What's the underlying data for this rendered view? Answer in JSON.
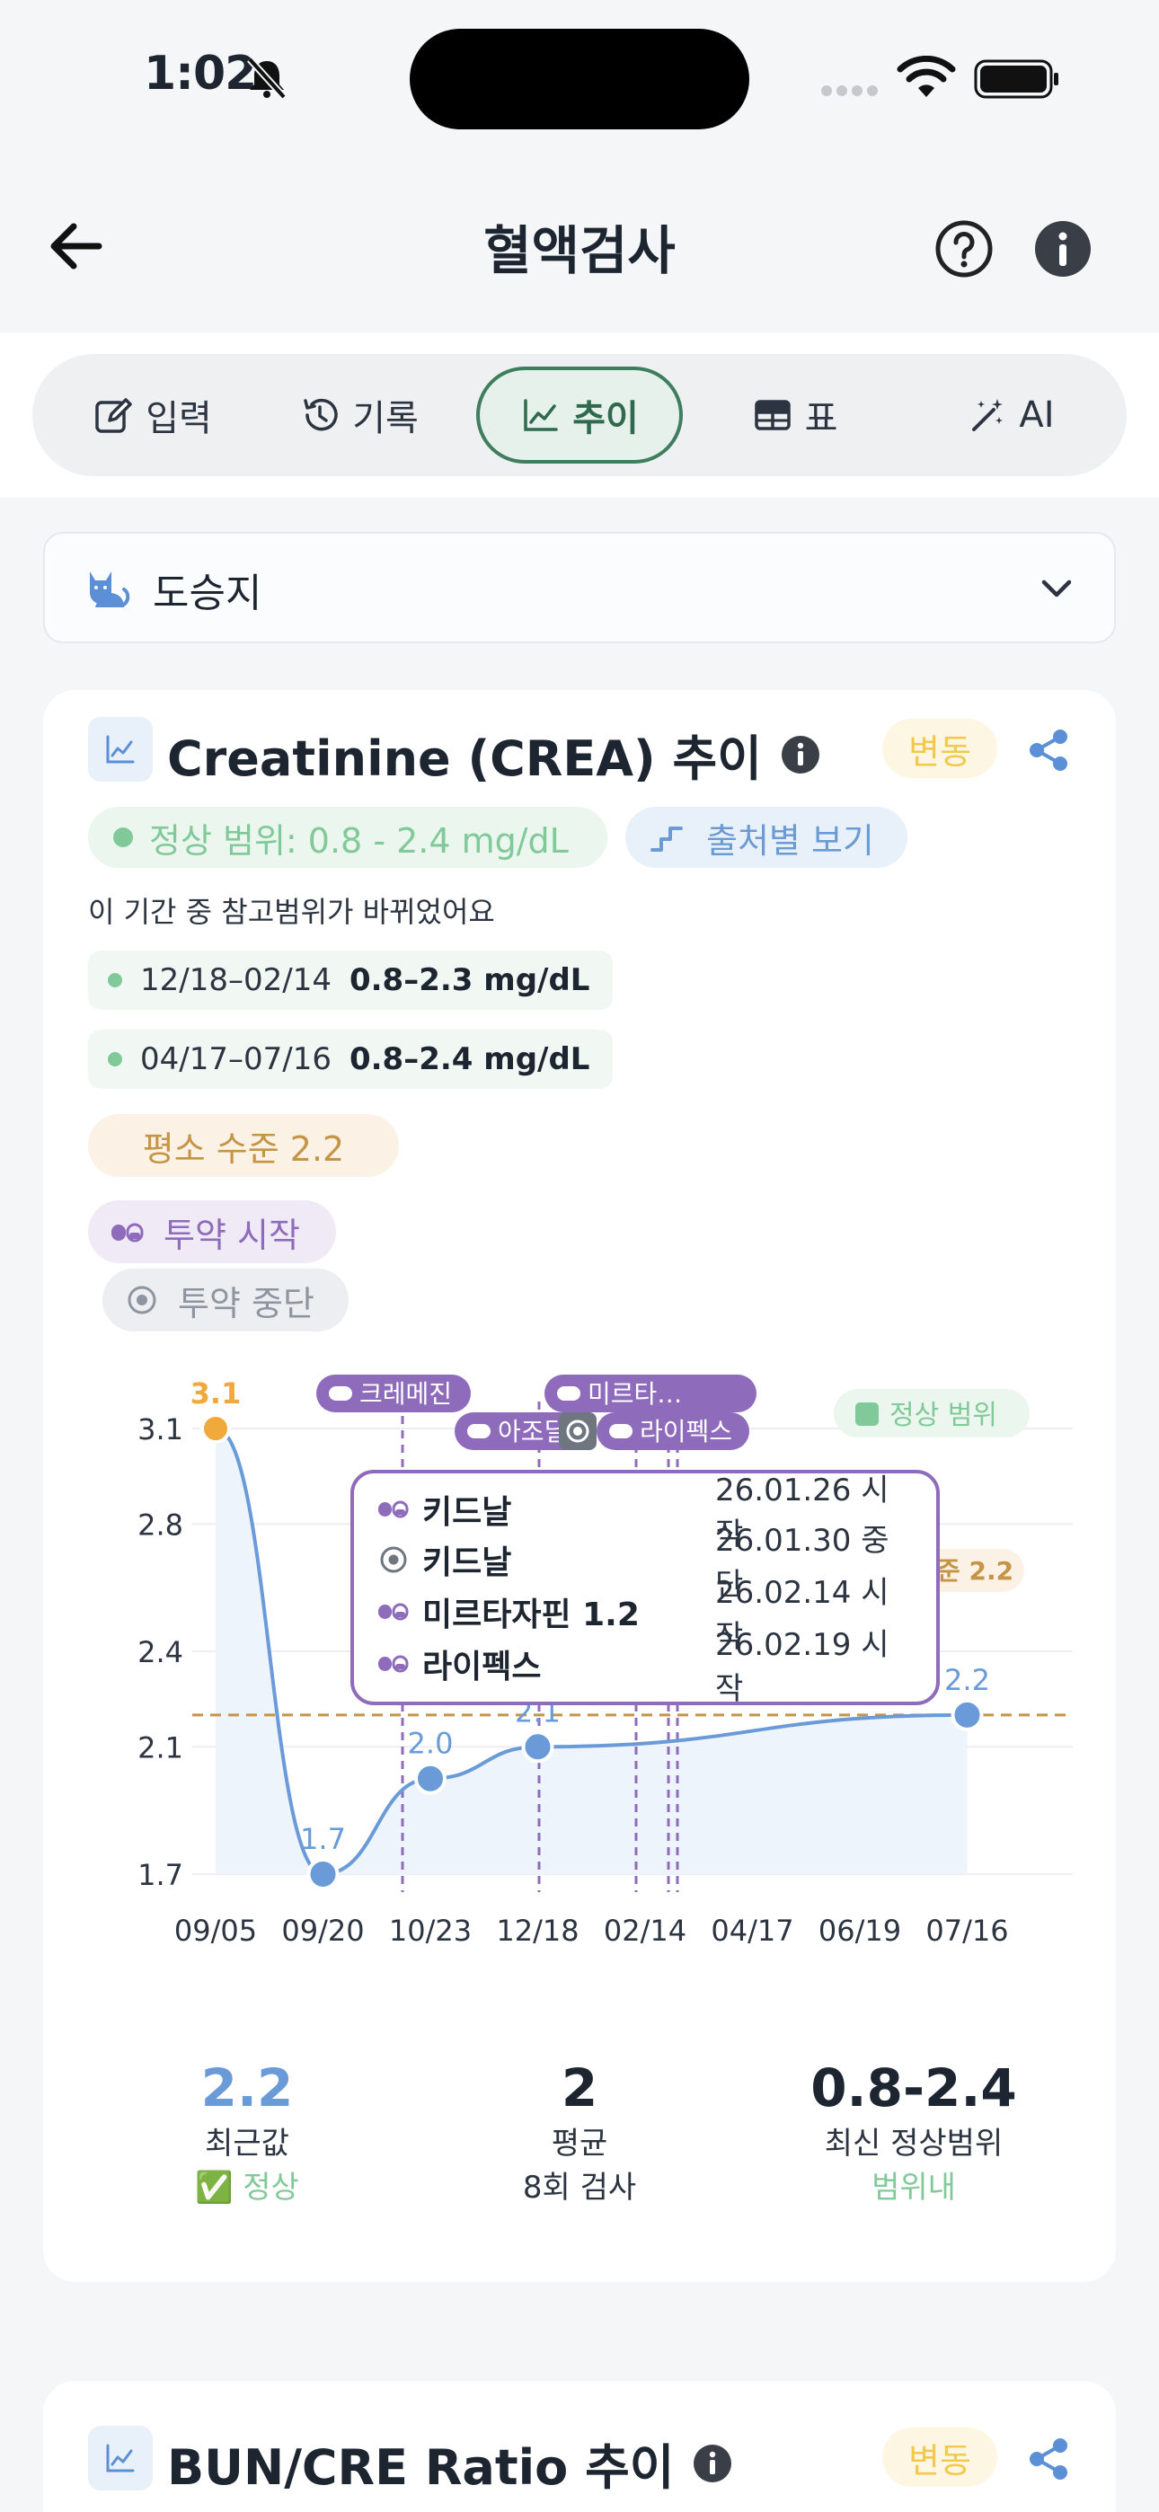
{
  "status": {
    "time": "1:02"
  },
  "header": {
    "title": "혈액검사"
  },
  "tabs": [
    {
      "label": "입력",
      "icon": "edit-icon"
    },
    {
      "label": "기록",
      "icon": "history-icon"
    },
    {
      "label": "추이",
      "icon": "trend-icon",
      "active": true
    },
    {
      "label": "표",
      "icon": "table-icon"
    },
    {
      "label": "AI",
      "icon": "magic-wand-icon"
    }
  ],
  "pet": {
    "name": "도승지"
  },
  "card": {
    "title": "Creatinine (CREA) 추이",
    "badge": "변동",
    "normal_range_pill": "정상 범위: 0.8 - 2.4 mg/dL",
    "source_pill": "출처별 보기",
    "range_note": "이 기간 중 참고범위가 바뀌었어요",
    "ranges": [
      {
        "period": "12/18–02/14",
        "value": "0.8–2.3 mg/dL"
      },
      {
        "period": "04/17–07/16",
        "value": "0.8–2.4 mg/dL"
      }
    ],
    "usual_pill": "평소 수준 2.2",
    "med_start_pill": "투약 시작",
    "med_stop_pill": "투약 중단"
  },
  "chart_data": {
    "type": "line",
    "title": "Creatinine (CREA) 추이",
    "categories": [
      "09/05",
      "09/20",
      "10/23",
      "12/18",
      "02/14",
      "04/17",
      "06/19",
      "07/16"
    ],
    "series": [
      {
        "values": [
          3.1,
          1.7,
          2.0,
          2.1,
          null,
          null,
          null,
          2.2
        ]
      }
    ],
    "point_labels": [
      "3.1",
      "1.7",
      "2.0",
      "2.1",
      "",
      "",
      "",
      "2.2"
    ],
    "y_ticks": [
      "3.1",
      "2.8",
      "2.4",
      "2.1",
      "1.7"
    ],
    "y_tick_values": [
      3.1,
      2.8,
      2.4,
      2.1,
      1.7
    ],
    "ylim": [
      1.7,
      3.1
    ],
    "usual_level": {
      "value": 2.2,
      "label": "평소 수준 2.2"
    },
    "normal_range_legend": "정상 범위",
    "med_markers": [
      {
        "label": "크레메진"
      },
      {
        "label": "아조딜"
      },
      {
        "label": "미르타…"
      },
      {
        "label": "라이펙스"
      }
    ],
    "colors": {
      "line": "#6a9bd8",
      "first_point": "#f2a93b",
      "usual": "#c49547",
      "med": "#8e6cbb",
      "normal": "#82c99a"
    }
  },
  "tooltip": {
    "rows": [
      {
        "icon": "pill-icon",
        "name": "키드날",
        "date": "26.01.26 시작"
      },
      {
        "icon": "stop-icon",
        "name": "키드날",
        "date": "26.01.30 중단"
      },
      {
        "icon": "pill-icon",
        "name": "미르타자핀 1.2",
        "date": "26.02.14 시작"
      },
      {
        "icon": "pill-icon",
        "name": "라이펙스",
        "date": "26.02.19 시작"
      }
    ]
  },
  "stats": [
    {
      "value": "2.2",
      "label": "최근값",
      "sub": "✅ 정상",
      "value_color": "#6a9bd8",
      "sub_color": "#82c99a"
    },
    {
      "value": "2",
      "label": "평균",
      "sub": "8회 검사",
      "value_color": "#1c2530",
      "sub_color": "#2b3440"
    },
    {
      "value": "0.8-2.4",
      "label": "최신 정상범위",
      "sub": "범위내",
      "value_color": "#1c2530",
      "sub_color": "#82c99a"
    }
  ],
  "card2": {
    "title": "BUN/CRE Ratio 추이",
    "badge": "변동"
  }
}
